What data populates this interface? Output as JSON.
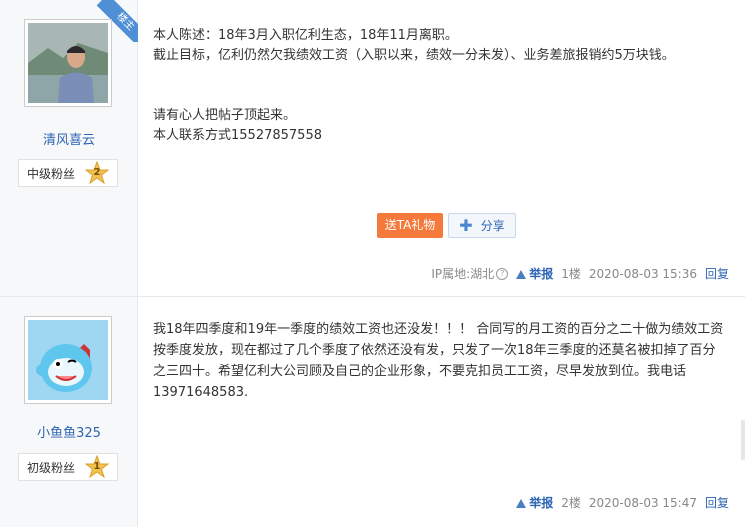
{
  "posts": [
    {
      "username": "清风喜云",
      "fan_level": "中级粉丝",
      "fan_level_num": "2",
      "op_tag": "楼主",
      "lines": [
        "本人陈述：18年3月入职亿利生态，18年11月离职。",
        "截止目标，亿利仍然欠我绩效工资（入职以来，绩效一分未发）、业务差旅报销约5万块钱。",
        "",
        "",
        "请有心人把帖子顶起来。",
        "本人联系方式15527857558"
      ],
      "gift_button": "送TA礼物",
      "share_button": "分享",
      "ip": "IP属地:湖北",
      "report": "举报",
      "floor": "1楼",
      "time": "2020-08-03 15:36",
      "reply": "回复"
    },
    {
      "username": "小鱼鱼325",
      "fan_level": "初级粉丝",
      "fan_level_num": "1",
      "text": "我18年四季度和19年一季度的绩效工资也还没发！！！ 合同写的月工资的百分之二十做为绩效工资按季度发放，现在都过了几个季度了依然还没有发，只发了一次18年三季度的还莫名被扣掉了百分之三四十。希望亿利大公司顾及自己的企业形象，不要克扣员工工资，尽早发放到位。我电话13971648583.",
      "report": "举报",
      "floor": "2楼",
      "time": "2020-08-03 15:47",
      "reply": "回复"
    }
  ],
  "colors": {
    "link": "#2d64b3",
    "gift": "#f5793a",
    "sidebar": "#f7f8fa"
  }
}
